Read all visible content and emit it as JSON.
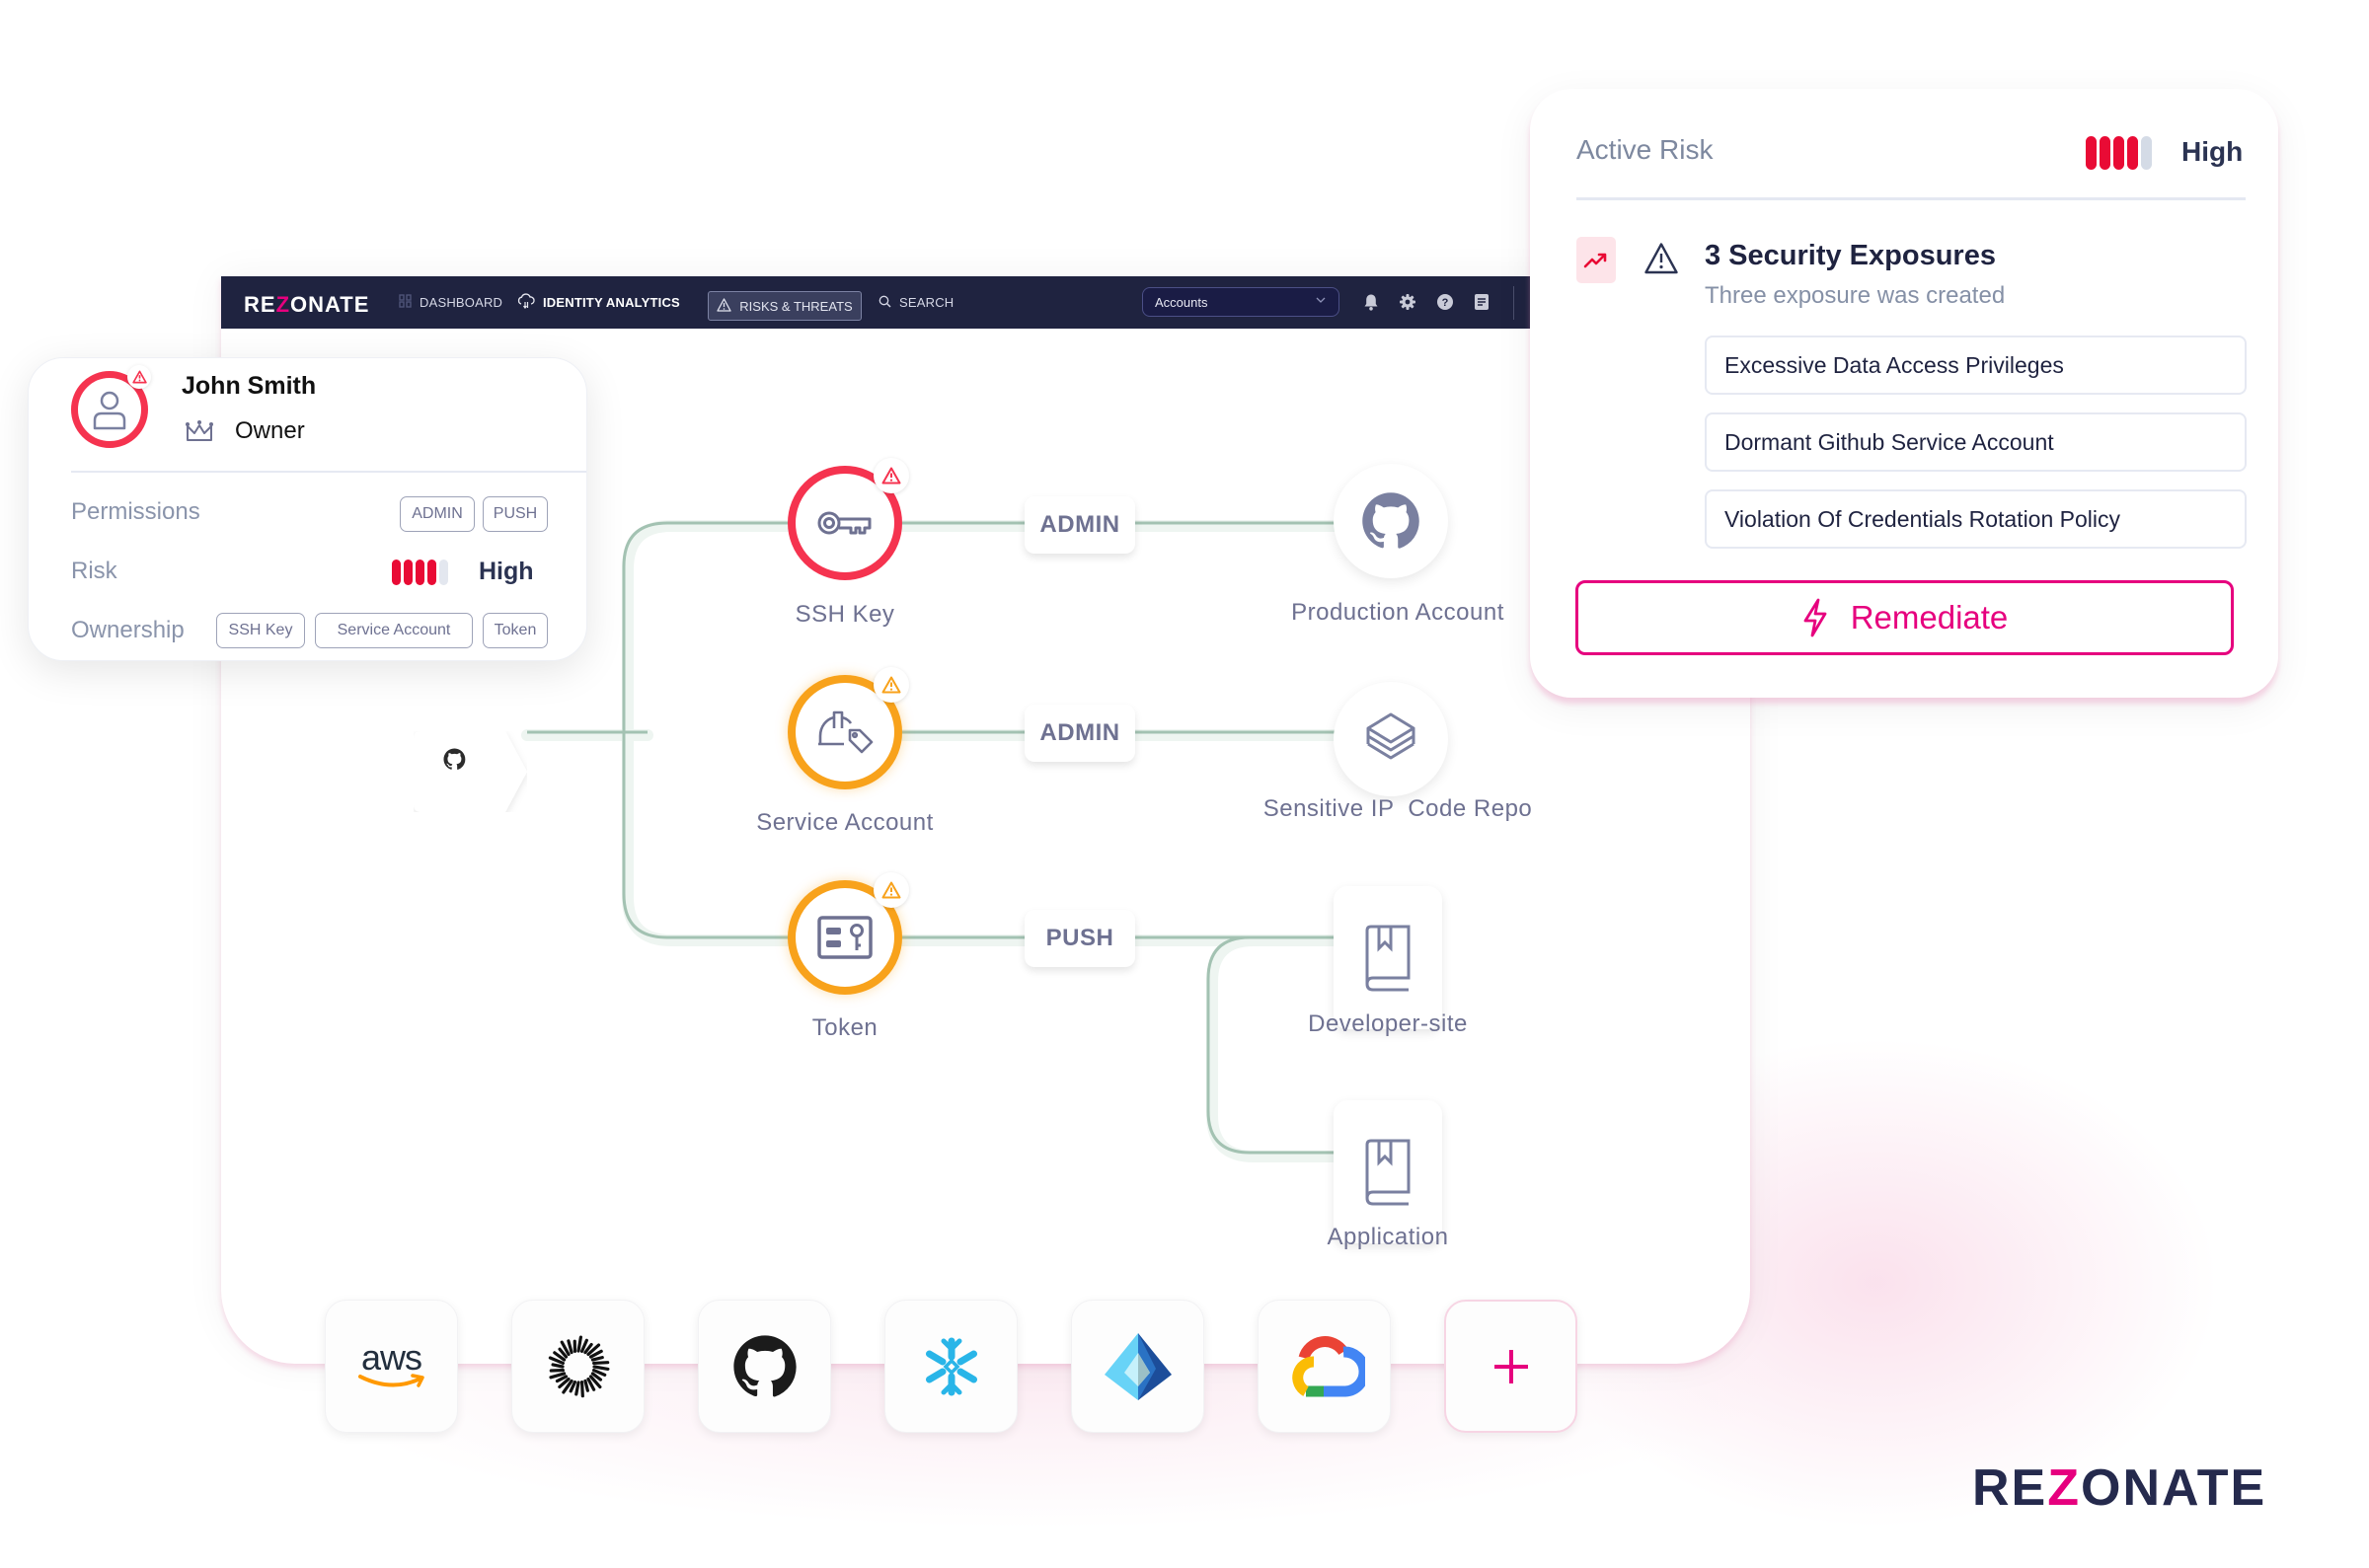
{
  "navbar": {
    "logo": {
      "pre": "RE",
      "z": "Z",
      "post": "ONATE"
    },
    "items": [
      {
        "label": "DASHBOARD",
        "icon": "dashboard-grid-icon"
      },
      {
        "label": "IDENTITY ANALYTICS",
        "icon": "cloud-analytics-icon"
      },
      {
        "label": "RISKS & THREATS",
        "icon": "warning-icon",
        "active": true
      },
      {
        "label": "SEARCH",
        "icon": "search-icon"
      }
    ],
    "accounts_select": {
      "value": "Accounts"
    },
    "icons": [
      "bell-icon",
      "gear-icon",
      "help-icon",
      "document-icon"
    ]
  },
  "user_card": {
    "name": "John Smith",
    "role": "Owner",
    "permissions_label": "Permissions",
    "permissions": [
      "ADMIN",
      "PUSH"
    ],
    "risk_label": "Risk",
    "risk_level": "High",
    "risk_score": {
      "filled": 4,
      "total": 5
    },
    "ownership_label": "Ownership",
    "ownership": [
      "SSH Key",
      "Service Account",
      "Token"
    ]
  },
  "graph": {
    "source": "GitHub",
    "identities": [
      {
        "label": "SSH Key",
        "status": "red",
        "permission": "ADMIN",
        "target": "Production Account"
      },
      {
        "label": "Service Account",
        "status": "orange",
        "permission": "ADMIN",
        "target": "Sensitive IP  Code Repo"
      },
      {
        "label": "Token",
        "status": "orange",
        "permission": "PUSH",
        "targets": [
          "Developer-site",
          "Application"
        ]
      }
    ]
  },
  "risk_card": {
    "title": "Active Risk",
    "level": "High",
    "score": {
      "filled": 4,
      "total": 5
    },
    "exposures_title": "3 Security Exposures",
    "exposures_subtitle": "Three exposure was created",
    "exposures": [
      "Excessive Data Access Privileges",
      "Dormant Github Service Account",
      "Violation Of Credentials Rotation Policy"
    ],
    "action_label": "Remediate"
  },
  "integrations": [
    {
      "name": "AWS",
      "label": "aws"
    },
    {
      "name": "Okta"
    },
    {
      "name": "GitHub"
    },
    {
      "name": "Snowflake"
    },
    {
      "name": "Azure AD"
    },
    {
      "name": "Google Cloud"
    },
    {
      "name": "Add integration",
      "label": "+"
    }
  ],
  "colors": {
    "brand_navy": "#1f2340",
    "brand_pink": "#e6007e",
    "risk_red": "#e90b35",
    "node_red": "#f5334f",
    "node_orange": "#f8a21b",
    "edge_green": "#9fbfae"
  },
  "brand": {
    "pre": "RE",
    "z": "Z",
    "post": "ONATE"
  }
}
